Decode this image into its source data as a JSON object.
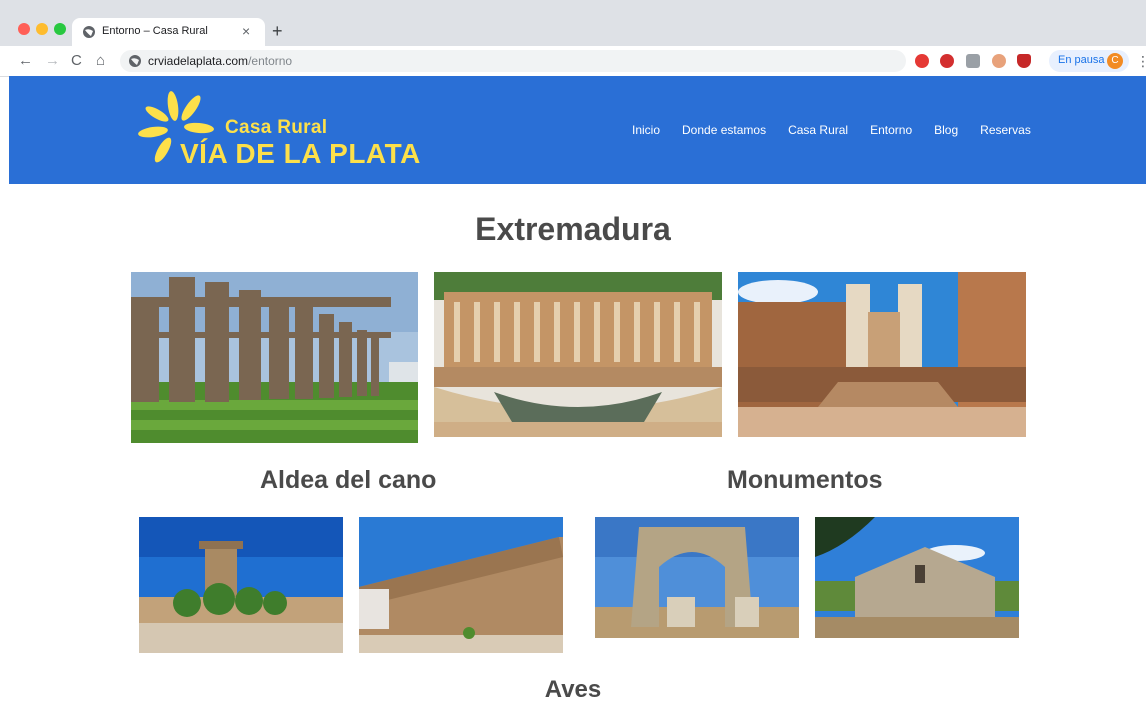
{
  "browser": {
    "tab_title": "Entorno – Casa Rural",
    "url_host": "crviadelaplata.com",
    "url_path": "/entorno",
    "new_tab_label": "+",
    "close_label": "×",
    "profile_status": "En pausa",
    "profile_initial": "C"
  },
  "site": {
    "logo_line1": "Casa Rural",
    "logo_line2": "VÍA DE LA PLATA",
    "logo_color": "#fde04a",
    "header_color": "#2a6fd6",
    "nav": [
      "Inicio",
      "Donde estamos",
      "Casa Rural",
      "Entorno",
      "Blog",
      "Reservas"
    ]
  },
  "content": {
    "section_main": "Extremadura",
    "section_aldea": "Aldea del cano",
    "section_monumentos": "Monumentos",
    "section_aves": "Aves"
  }
}
